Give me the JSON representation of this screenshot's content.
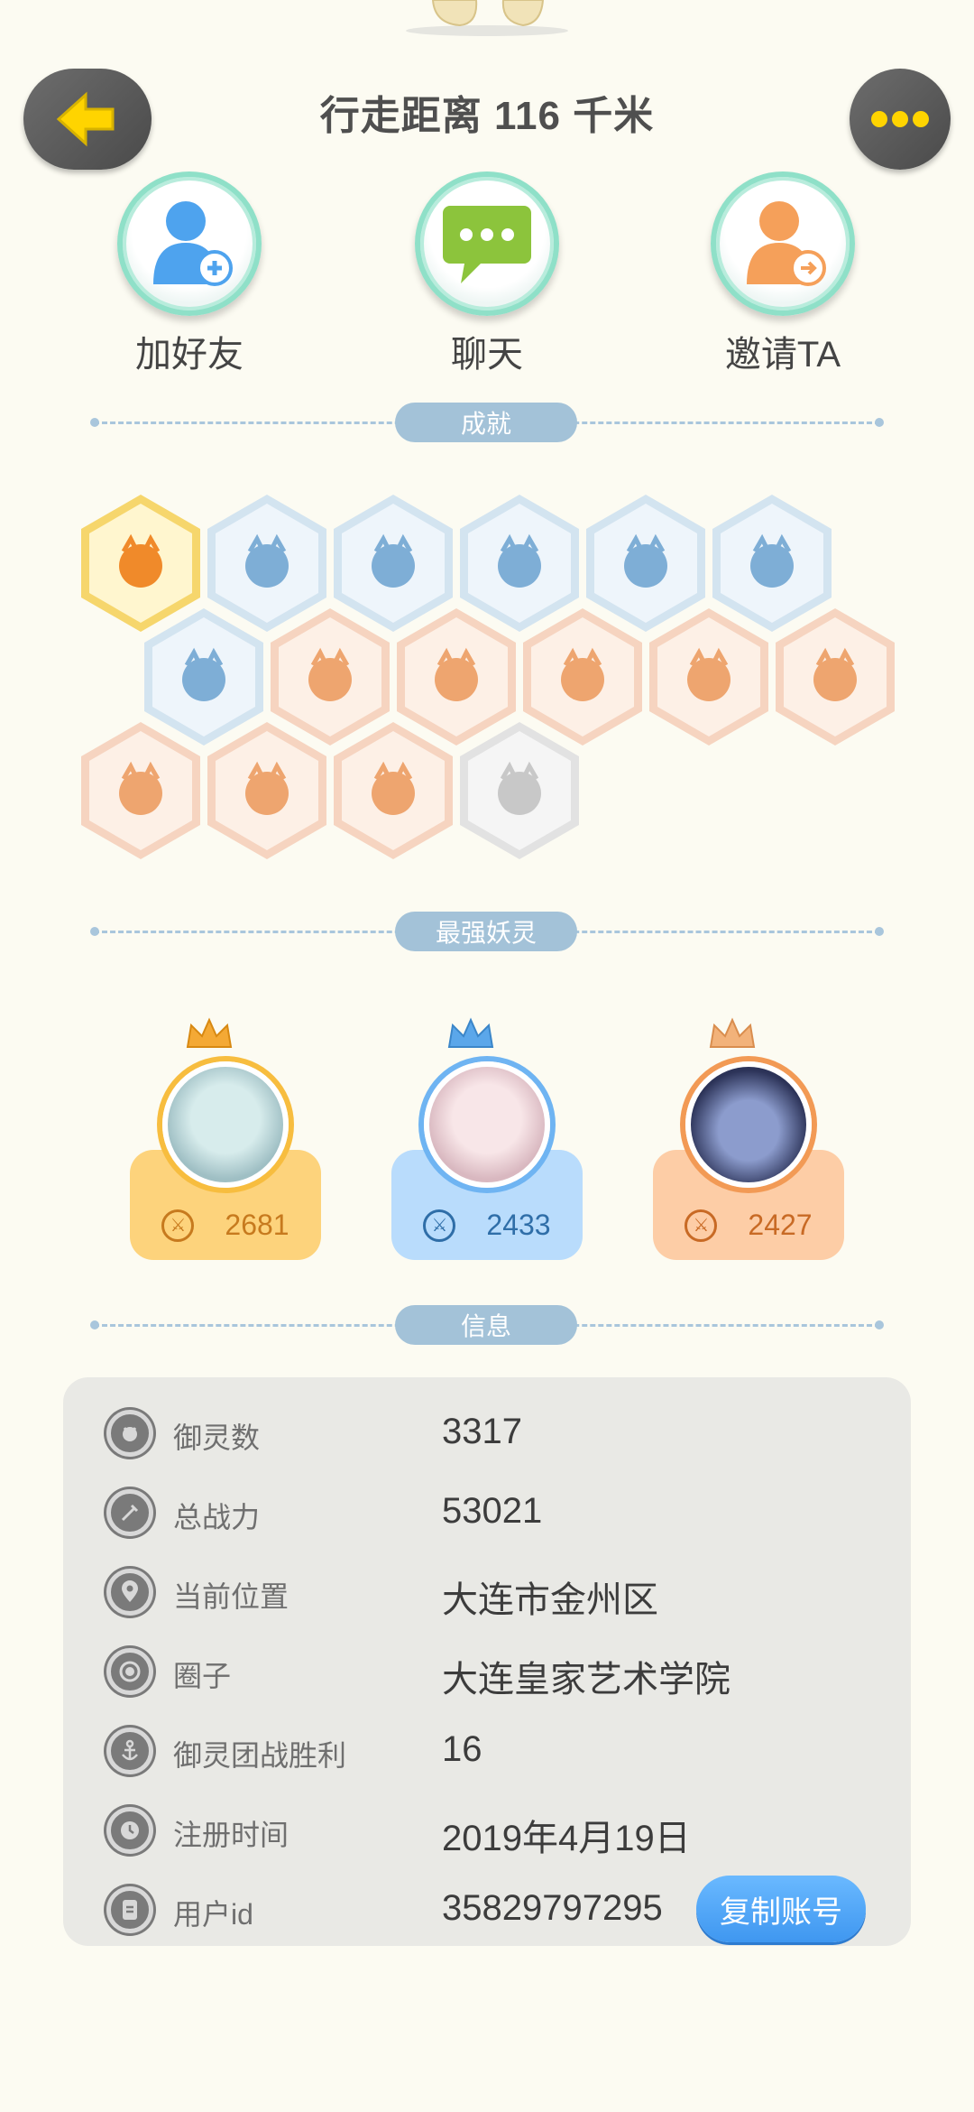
{
  "header": {
    "back_icon": "back-arrow-icon",
    "title": "行走距离 116 千米",
    "more_icon": "more-dots-icon"
  },
  "actions": [
    {
      "label": "加好友",
      "icon": "add-friend-icon",
      "color": "#4ea3ee"
    },
    {
      "label": "聊天",
      "icon": "chat-icon",
      "color": "#8cc43c"
    },
    {
      "label": "邀请TA",
      "icon": "invite-icon",
      "color": "#f5a05a"
    }
  ],
  "sections": {
    "achievements": "成就",
    "strongest": "最强妖灵",
    "info": "信息"
  },
  "achievements": [
    {
      "icon": "fox-badge-icon",
      "style": "gold"
    },
    {
      "icon": "sneaker-badge-icon",
      "style": "blue"
    },
    {
      "icon": "radar-badge-icon",
      "style": "blue"
    },
    {
      "icon": "moon-badge-icon",
      "style": "blue"
    },
    {
      "icon": "crystal-ball-badge-icon",
      "style": "blue"
    },
    {
      "icon": "yinyang-book-badge-icon",
      "style": "blue"
    },
    {
      "icon": "spirit-badge-icon",
      "style": "blue"
    },
    {
      "icon": "egg-badge-icon",
      "style": "peach"
    },
    {
      "icon": "swirl-badge-icon",
      "style": "peach"
    },
    {
      "icon": "monkey-badge-icon",
      "style": "peach"
    },
    {
      "icon": "cart-badge-icon",
      "style": "peach"
    },
    {
      "icon": "cat-badge-icon",
      "style": "peach"
    },
    {
      "icon": "koi-badge-icon",
      "style": "peach"
    },
    {
      "icon": "shield-badge-icon",
      "style": "peach"
    },
    {
      "icon": "ox-badge-icon",
      "style": "peach"
    },
    {
      "icon": "wolf-book-badge-icon",
      "style": "grey"
    }
  ],
  "strongest_spirits": [
    {
      "power": "2681",
      "card_color": "#fdd37c",
      "ring_color": "#f7bd3f",
      "text_color": "#c77a1e",
      "crown_color": "#f4a935"
    },
    {
      "power": "2433",
      "card_color": "#b9dcfc",
      "ring_color": "#6fb4f2",
      "text_color": "#2f6ea8",
      "crown_color": "#5ba7ea"
    },
    {
      "power": "2427",
      "card_color": "#fdcda6",
      "ring_color": "#f29a55",
      "text_color": "#c86a25",
      "crown_color": "#f2b27a"
    }
  ],
  "info_rows": [
    {
      "label": "御灵数",
      "value": "3317",
      "icon": "spirit-count-icon"
    },
    {
      "label": "总战力",
      "value": "53021",
      "icon": "sword-icon"
    },
    {
      "label": "当前位置",
      "value": "大连市金州区",
      "icon": "location-pin-icon"
    },
    {
      "label": "圈子",
      "value": "大连皇家艺术学院",
      "icon": "circle-group-icon"
    },
    {
      "label": "御灵团战胜利",
      "value": "16",
      "icon": "anchor-icon"
    },
    {
      "label": "注册时间",
      "value": "2019年4月19日",
      "icon": "clock-icon"
    },
    {
      "label": "用户id",
      "value": "35829797295",
      "icon": "id-card-icon"
    }
  ],
  "copy_button": "复制账号"
}
